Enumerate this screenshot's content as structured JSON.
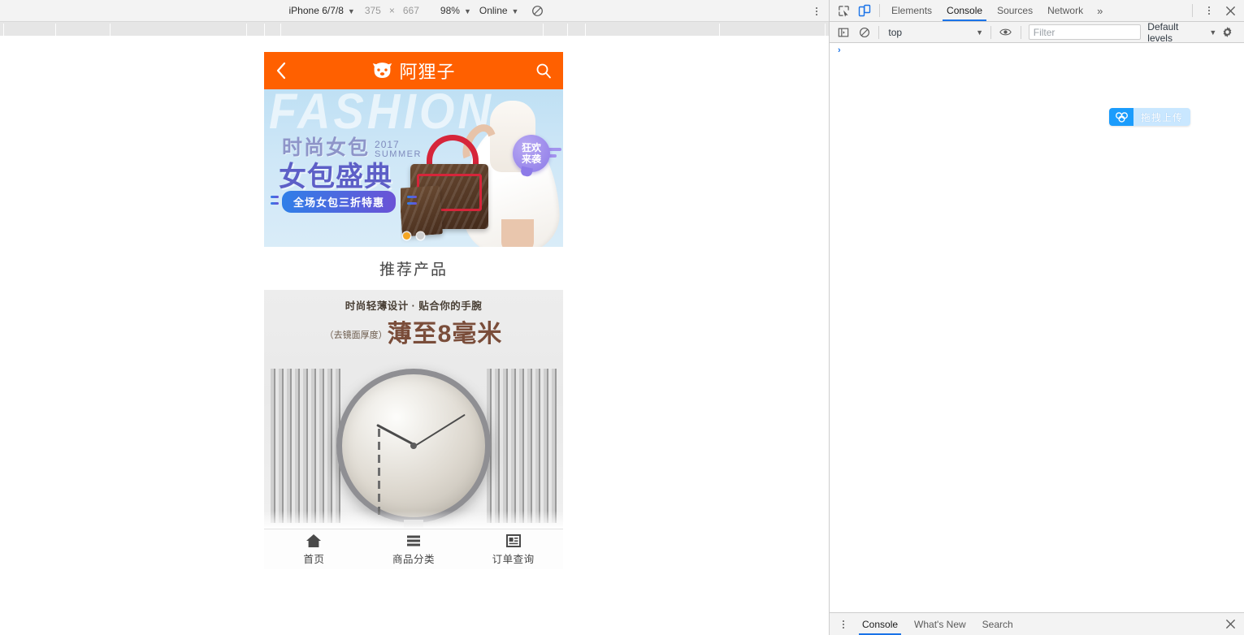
{
  "device_toolbar": {
    "device_name": "iPhone 6/7/8",
    "width": "375",
    "x_separator": "×",
    "height": "667",
    "zoom": "98%",
    "network": "Online",
    "throttle_icon": "no-throttling-icon",
    "menu_icon": "kebab-menu-icon"
  },
  "ruler": {
    "ticks": [
      4,
      68,
      135,
      303,
      325,
      345,
      668,
      698,
      720,
      885,
      1015
    ]
  },
  "mobile_page": {
    "header": {
      "back_icon": "chevron-left-icon",
      "logo_icon": "cat-face-logo-icon",
      "brand": "阿狸子",
      "search_icon": "search-icon",
      "bg_color": "#ff6000"
    },
    "banner": {
      "background_word": "FASHION",
      "title_line1": "时尚女包",
      "year": "2017",
      "season": "SUMMER",
      "title_line2": "女包盛典",
      "promo_badge": "全场女包三折特惠",
      "round_badge_line1": "狂欢",
      "round_badge_line2": "来袭",
      "dots": [
        {
          "active": true
        },
        {
          "active": false
        }
      ]
    },
    "section_title": "推荐产品",
    "watch_ad": {
      "line1": "时尚轻薄设计 · 贴合你的手腕",
      "paren": "（去镜面厚度）",
      "headline": "薄至8毫米"
    },
    "bottom_nav": [
      {
        "label": "首页",
        "icon": "home-icon"
      },
      {
        "label": "商品分类",
        "icon": "list-lines-icon"
      },
      {
        "label": "订单查询",
        "icon": "news-card-icon"
      }
    ]
  },
  "devtools": {
    "toolbar": {
      "inspect_icon": "inspect-element-icon",
      "device_toggle_icon": "toggle-device-toolbar-icon",
      "tabs": [
        {
          "label": "Elements",
          "active": false
        },
        {
          "label": "Console",
          "active": true
        },
        {
          "label": "Sources",
          "active": false
        },
        {
          "label": "Network",
          "active": false
        }
      ],
      "more_tabs": "»",
      "menu_icon": "kebab-menu-icon",
      "close_icon": "close-icon",
      "accent_color": "#1a73e8"
    },
    "console_toolbar": {
      "sidebar_icon": "console-sidebar-icon",
      "clear_icon": "clear-console-icon",
      "context": "top",
      "eye_icon": "live-expression-eye-icon",
      "filter_placeholder": "Filter",
      "levels": "Default levels",
      "settings_icon": "gear-icon"
    },
    "console": {
      "prompt": "›",
      "upload_badge": {
        "icon": "cloud-upload-icon",
        "text": "拖拽上传"
      }
    },
    "drawer_tabs": [
      {
        "label": "Console",
        "active": true
      },
      {
        "label": "What's New",
        "active": false
      },
      {
        "label": "Search",
        "active": false
      }
    ],
    "drawer_menu_icon": "kebab-menu-icon",
    "drawer_close_icon": "close-icon"
  }
}
